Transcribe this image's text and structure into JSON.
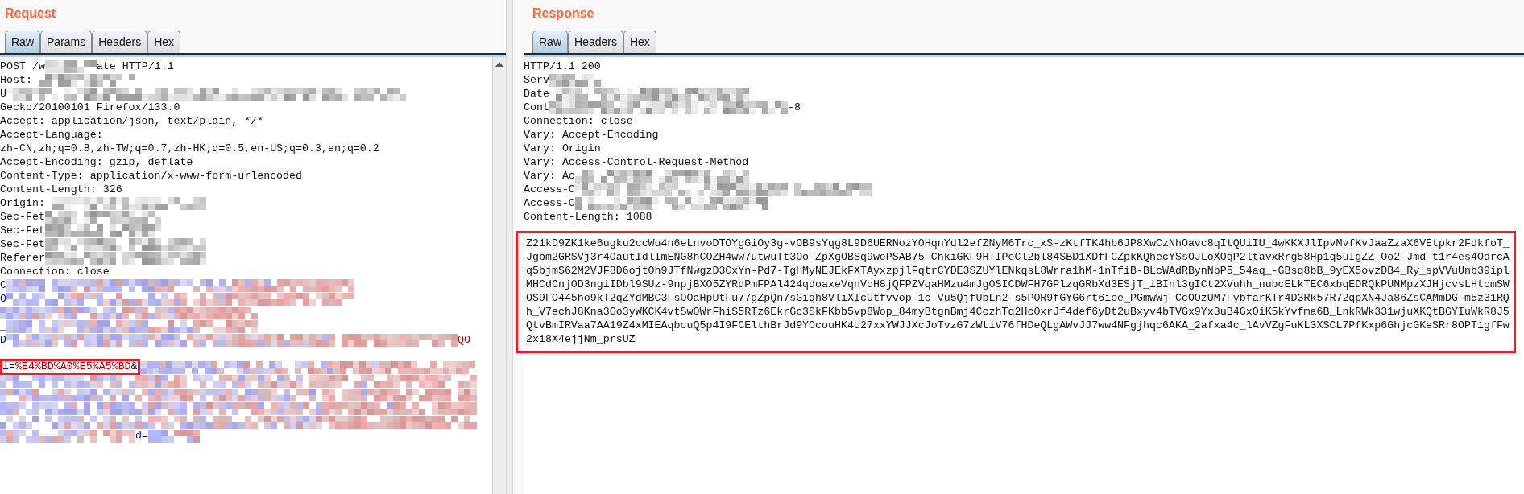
{
  "request": {
    "title": "Request",
    "tabs": [
      {
        "label": "Raw",
        "selected": true
      },
      {
        "label": "Params",
        "selected": false
      },
      {
        "label": "Headers",
        "selected": false
      },
      {
        "label": "Hex",
        "selected": false
      }
    ],
    "lines": [
      {
        "kind": "text",
        "parts": [
          {
            "kind": "text",
            "text": "POST /w"
          },
          {
            "kind": "mosaic"
          },
          {
            "kind": "text",
            "text": "ate HTTP/1.1"
          }
        ]
      },
      {
        "kind": "text",
        "parts": [
          {
            "kind": "text",
            "text": "Host: "
          },
          {
            "kind": "mosaic"
          }
        ]
      },
      {
        "kind": "text",
        "parts": [
          {
            "kind": "text",
            "text": "U"
          },
          {
            "kind": "mosaic"
          }
        ]
      },
      {
        "kind": "text",
        "parts": [
          {
            "kind": "text",
            "text": "Gecko/20100101 Firefox/133.0"
          }
        ]
      },
      {
        "kind": "text",
        "parts": [
          {
            "kind": "text",
            "text": "Accept: application/json, text/plain, */*"
          }
        ]
      },
      {
        "kind": "text",
        "parts": [
          {
            "kind": "text",
            "text": "Accept-Language:"
          }
        ]
      },
      {
        "kind": "text",
        "parts": [
          {
            "kind": "text",
            "text": "zh-CN,zh;q=0.8,zh-TW;q=0.7,zh-HK;q=0.5,en-US;q=0.3,en;q=0.2"
          }
        ]
      },
      {
        "kind": "text",
        "parts": [
          {
            "kind": "text",
            "text": "Accept-Encoding: gzip, deflate"
          }
        ]
      },
      {
        "kind": "text",
        "parts": [
          {
            "kind": "text",
            "text": "Content-Type: application/x-www-form-urlencoded"
          }
        ]
      },
      {
        "kind": "text",
        "parts": [
          {
            "kind": "text",
            "text": "Content-Length: 326"
          }
        ]
      },
      {
        "kind": "text",
        "parts": [
          {
            "kind": "text",
            "text": "Origin:"
          },
          {
            "kind": "mosaic"
          }
        ]
      },
      {
        "kind": "text",
        "parts": [
          {
            "kind": "text",
            "text": "Sec-Fet"
          },
          {
            "kind": "mosaic"
          }
        ]
      },
      {
        "kind": "text",
        "parts": [
          {
            "kind": "text",
            "text": "Sec-Fet"
          },
          {
            "kind": "mosaic"
          }
        ]
      },
      {
        "kind": "text",
        "parts": [
          {
            "kind": "text",
            "text": "Sec-Fet"
          },
          {
            "kind": "mosaic"
          }
        ]
      },
      {
        "kind": "text",
        "parts": [
          {
            "kind": "text",
            "text": "Referer"
          },
          {
            "kind": "mosaic"
          }
        ]
      },
      {
        "kind": "text",
        "parts": [
          {
            "kind": "text",
            "text": "Connection: close"
          }
        ]
      },
      {
        "kind": "text",
        "parts": [
          {
            "kind": "text",
            "text": "C"
          },
          {
            "kind": "tinted"
          }
        ]
      },
      {
        "kind": "text",
        "parts": [
          {
            "kind": "name",
            "text": "O"
          },
          {
            "kind": "tinted"
          }
        ]
      },
      {
        "kind": "text",
        "parts": [
          {
            "kind": "tinted"
          }
        ]
      },
      {
        "kind": "text",
        "parts": [
          {
            "kind": "name",
            "text": "_"
          },
          {
            "kind": "tinted"
          }
        ]
      },
      {
        "kind": "text",
        "parts": [
          {
            "kind": "name",
            "text": "D"
          },
          {
            "kind": "tinted"
          },
          {
            "kind": "value",
            "text": "QO"
          }
        ]
      },
      {
        "kind": "blank"
      },
      {
        "kind": "text",
        "parts": [
          {
            "kind": "frame",
            "parts": [
              {
                "kind": "name",
                "text": "i"
              },
              {
                "kind": "text",
                "text": "="
              },
              {
                "kind": "value",
                "text": "%E4%BD%A0%E5%A5%BD"
              },
              {
                "kind": "text",
                "text": "&"
              }
            ]
          },
          {
            "kind": "tinted"
          }
        ]
      },
      {
        "kind": "text",
        "parts": [
          {
            "kind": "tinted"
          }
        ]
      },
      {
        "kind": "text",
        "parts": [
          {
            "kind": "tinted"
          }
        ]
      },
      {
        "kind": "text",
        "parts": [
          {
            "kind": "tinted"
          }
        ]
      },
      {
        "kind": "text",
        "parts": [
          {
            "kind": "tinted"
          }
        ]
      },
      {
        "kind": "text",
        "parts": [
          {
            "kind": "tinted"
          },
          {
            "kind": "name",
            "text": "d"
          },
          {
            "kind": "text",
            "text": "="
          },
          {
            "kind": "tinted"
          }
        ]
      }
    ]
  },
  "response": {
    "title": "Response",
    "tabs": [
      {
        "label": "Raw",
        "selected": true
      },
      {
        "label": "Headers",
        "selected": false
      },
      {
        "label": "Hex",
        "selected": false
      }
    ],
    "lines": [
      {
        "kind": "text",
        "parts": [
          {
            "kind": "text",
            "text": "HTTP/1.1 200"
          }
        ]
      },
      {
        "kind": "text",
        "parts": [
          {
            "kind": "text",
            "text": "Serv"
          },
          {
            "kind": "mosaic"
          }
        ]
      },
      {
        "kind": "text",
        "parts": [
          {
            "kind": "text",
            "text": "Date"
          },
          {
            "kind": "mosaic"
          }
        ]
      },
      {
        "kind": "text",
        "parts": [
          {
            "kind": "text",
            "text": "Cont"
          },
          {
            "kind": "mosaic"
          },
          {
            "kind": "text",
            "text": "-8"
          }
        ]
      },
      {
        "kind": "text",
        "parts": [
          {
            "kind": "text",
            "text": "Connection: close"
          }
        ]
      },
      {
        "kind": "text",
        "parts": [
          {
            "kind": "text",
            "text": "Vary: Accept-Encoding"
          }
        ]
      },
      {
        "kind": "text",
        "parts": [
          {
            "kind": "text",
            "text": "Vary: Origin"
          }
        ]
      },
      {
        "kind": "text",
        "parts": [
          {
            "kind": "text",
            "text": "Vary: Access-Control-Request-Method"
          }
        ]
      },
      {
        "kind": "text",
        "parts": [
          {
            "kind": "text",
            "text": "Vary: Ac"
          },
          {
            "kind": "mosaic"
          }
        ]
      },
      {
        "kind": "text",
        "parts": [
          {
            "kind": "text",
            "text": "Access-C"
          },
          {
            "kind": "mosaic"
          }
        ]
      },
      {
        "kind": "text",
        "parts": [
          {
            "kind": "text",
            "text": "Access-C"
          },
          {
            "kind": "mosaic"
          }
        ]
      },
      {
        "kind": "text",
        "parts": [
          {
            "kind": "text",
            "text": "Content-Length: 1088"
          }
        ]
      }
    ],
    "body": {
      "highlighted": true,
      "lines": [
        "Z21kD9ZK1ke6ugku2ccWu4n6eLnvoDTOYgGiOy3g-vOB9sYqg8L9D6UERNozYOHqnYdl2efZNyM6Trc_xS-zKtfTK4hb6JP8XwCzNhOavc8qItQUiIU_4wKKXJlIpvMvfKvJaaZzaX6VEtpkr2FdkfoT_",
        "Jgbm2GRSVj3r4OautIdlImENG8hCOZH4ww7utwuTt3Oo_ZpXgOBSq9wePSAB75-ChkiGKF9HTIPeCl2bl84SBD1XDfFCZpkKQhecYSsOJLoXOqP2ltavxRrg58Hp1q5uIgZZ_Oo2-Jmd-t1r4es4OdrcA",
        "q5bjmS62M2VJF8D6ojtOh9JTfNwgzD3CxYn-Pd7-TgHMyNEJEkFXTAyxzpjlFqtrCYDE3SZUYlENkqsL8Wrra1hM-1nTfiB-BLcWAdRBynNpP5_54aq_-GBsq8bB_9yEX5ovzDB4_Ry_spVVuUnb39ipl",
        "MHCdCnjOD3ngiIDbl9SUz-9npjBXO5ZYRdPmFPAl424qdoaxeVqnVoH8jQFPZVqaHMzu4mJgOSICDWFH7GPlzqGRbXd3ESjT_iBInl3gICt2XVuhh_nubcELkTEC6xbqEDRQkPUNMpzXJHjcvsLHtcmSW",
        "OS9FO445ho9kT2qZYdMBC3FsOOaHpUtFu77gZpQn7sGiqh8VliXIcUtfvvop-1c-Vu5QjfUbLn2-s5POR9fGYG6rt6ioe_PGmwWj-CcOOzUM7FybfarKTr4D3Rk57R72qpXN4Ja86ZsCAMmDG-m5z31RQ",
        "h_V7echJ8Kna3Go3yWKCK4vtSwOWrFhiS5RTz6EkrGc3SkFKbb5vp8Wop_84myBtgnBmj4CczhTq2HcOxrJf4def6yDt2uBxyv4bTVGx9Yx3uB4GxOiK5kYvfma6B_LnkRWk331wjuXKQtBGYIuWkR8J5",
        "QtvBmIRVaa7AA19Z4xMIEAqbcuQ5p4I9FCElthBrJd9YOcouHK4U27xxYWJJXcJoTvzG7zWtiV76fHDeQLgAWvJJ7ww4NFgjhqc6AKA_2afxa4c_lAvVZgFuKL3XSCL7PfKxp6GhjcGKeSRr8OPT1gfFw",
        "2xi8X4ejjNm_prsUZ"
      ]
    }
  }
}
